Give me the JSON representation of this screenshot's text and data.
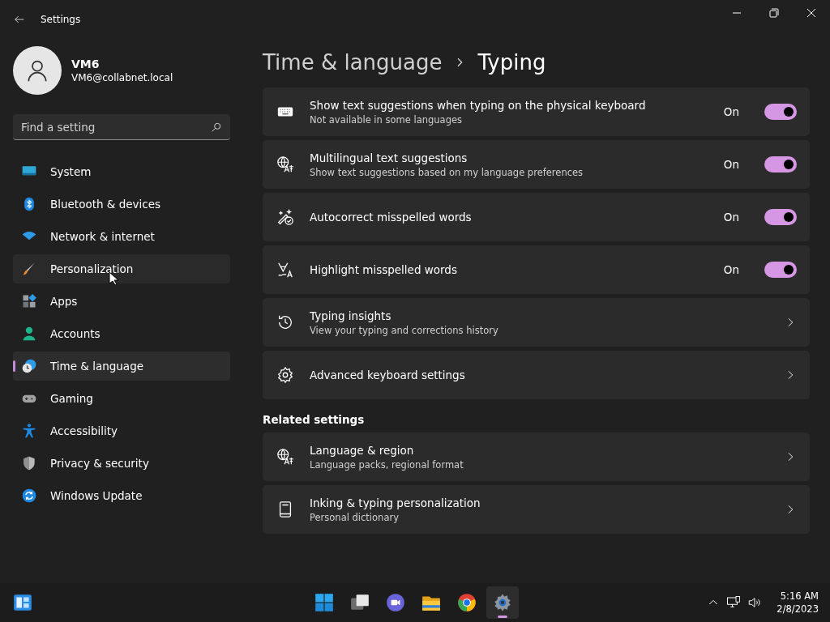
{
  "window": {
    "title": "Settings"
  },
  "profile": {
    "name": "VM6",
    "email": "VM6@collabnet.local"
  },
  "search": {
    "placeholder": "Find a setting"
  },
  "nav": [
    {
      "kind": "system",
      "label": "System",
      "selected": false,
      "hovered": false
    },
    {
      "kind": "bluetooth",
      "label": "Bluetooth & devices",
      "selected": false,
      "hovered": false
    },
    {
      "kind": "network",
      "label": "Network & internet",
      "selected": false,
      "hovered": false
    },
    {
      "kind": "personalization",
      "label": "Personalization",
      "selected": false,
      "hovered": true
    },
    {
      "kind": "apps",
      "label": "Apps",
      "selected": false,
      "hovered": false
    },
    {
      "kind": "accounts",
      "label": "Accounts",
      "selected": false,
      "hovered": false
    },
    {
      "kind": "time",
      "label": "Time & language",
      "selected": true,
      "hovered": false
    },
    {
      "kind": "gaming",
      "label": "Gaming",
      "selected": false,
      "hovered": false
    },
    {
      "kind": "accessibility",
      "label": "Accessibility",
      "selected": false,
      "hovered": false
    },
    {
      "kind": "privacy",
      "label": "Privacy & security",
      "selected": false,
      "hovered": false
    },
    {
      "kind": "update",
      "label": "Windows Update",
      "selected": false,
      "hovered": false
    }
  ],
  "breadcrumb": [
    "Time & language",
    "Typing"
  ],
  "settings": [
    {
      "kind": "keyboard",
      "title": "Show text suggestions when typing on the physical keyboard",
      "subtitle": "Not available in some languages",
      "state_label": "On",
      "on": true
    },
    {
      "kind": "language",
      "title": "Multilingual text suggestions",
      "subtitle": "Show text suggestions based on my language preferences",
      "state_label": "On",
      "on": true
    },
    {
      "kind": "autocorrect",
      "title": "Autocorrect misspelled words",
      "state_label": "On",
      "on": true
    },
    {
      "kind": "highlight",
      "title": "Highlight misspelled words",
      "state_label": "On",
      "on": true
    },
    {
      "kind": "history",
      "title": "Typing insights",
      "subtitle": "View your typing and corrections history"
    },
    {
      "kind": "gear",
      "title": "Advanced keyboard settings"
    }
  ],
  "related": {
    "title": "Related settings",
    "items": [
      {
        "kind": "language",
        "title": "Language & region",
        "subtitle": "Language packs, regional format"
      },
      {
        "kind": "book",
        "title": "Inking & typing personalization",
        "subtitle": "Personal dictionary"
      }
    ]
  },
  "taskbar": {
    "apps": [
      {
        "kind": "start",
        "active": false
      },
      {
        "kind": "taskview",
        "active": false
      },
      {
        "kind": "chat",
        "active": false
      },
      {
        "kind": "explorer",
        "active": false
      },
      {
        "kind": "browser",
        "active": false
      },
      {
        "kind": "settings",
        "active": true
      }
    ],
    "time": "5:16 AM",
    "date": "2/8/2023"
  }
}
